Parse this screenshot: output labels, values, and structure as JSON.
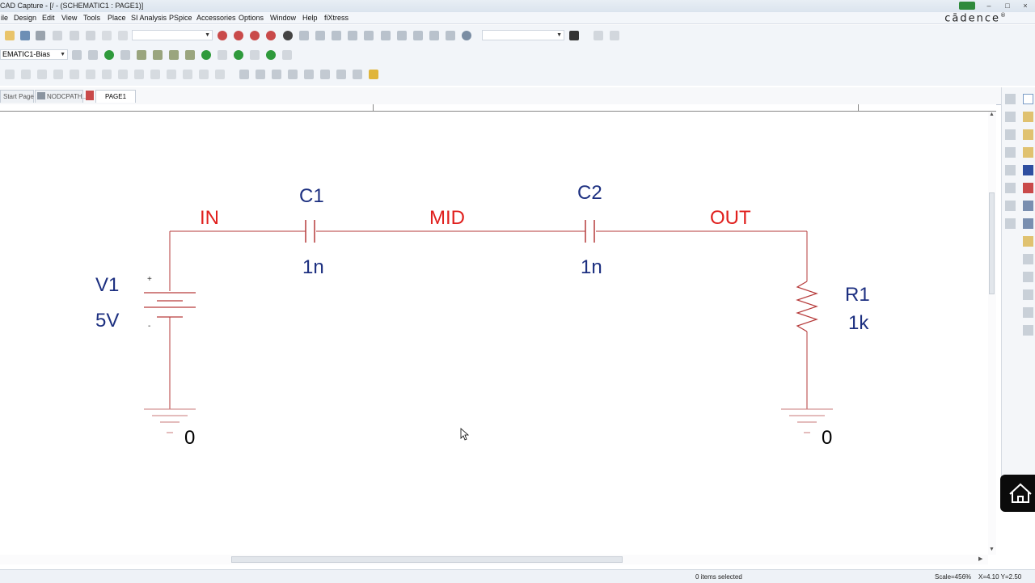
{
  "window": {
    "title": "CAD Capture - [/ - (SCHEMATIC1 : PAGE1)]",
    "controls": [
      "–",
      "□",
      "×"
    ],
    "logo": "cādence",
    "logo_mark": "®"
  },
  "menu": [
    "ile",
    "Design",
    "Edit",
    "View",
    "Tools",
    "Place",
    "SI Analysis",
    "PSpice",
    "Accessories",
    "Options",
    "Window",
    "Help",
    "fiXtress"
  ],
  "toolbar": {
    "profile_select": "EMATIC1-Bias"
  },
  "tabs": [
    {
      "label": "Start Page",
      "active": false
    },
    {
      "label": "NODCPATH...",
      "active": false
    },
    {
      "label": "PAGE1",
      "active": true
    }
  ],
  "schematic": {
    "nets": {
      "in": "IN",
      "mid": "MID",
      "out": "OUT"
    },
    "parts": {
      "c1": {
        "ref": "C1",
        "value": "1n"
      },
      "c2": {
        "ref": "C2",
        "value": "1n"
      },
      "v1": {
        "ref": "V1",
        "value": "5V",
        "plus": "+",
        "minus": "-"
      },
      "r1": {
        "ref": "R1",
        "value": "1k"
      }
    },
    "grounds": {
      "left": "0",
      "right": "0"
    }
  },
  "status": {
    "selection": "0 items selected",
    "scale": "Scale=456%",
    "coords": "X=4.10  Y=2.50"
  },
  "colors": {
    "wire": "#b63a3a",
    "net_label": "#e0201e",
    "part_label": "#1c2f80",
    "component": "#b63a3a"
  }
}
